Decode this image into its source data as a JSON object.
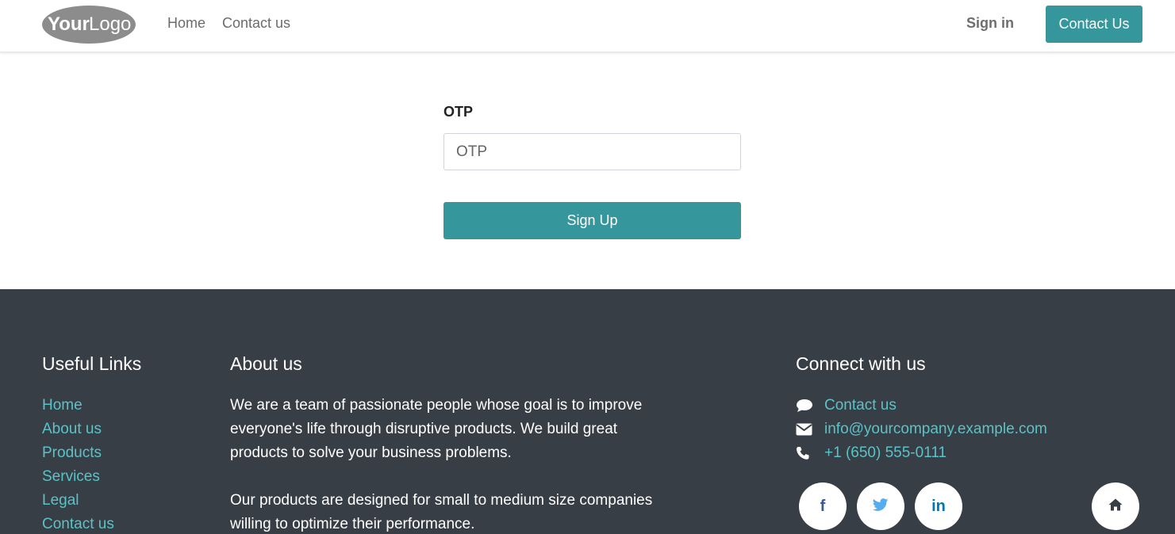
{
  "header": {
    "logo": {
      "text_bold": "Your",
      "text_light": "Logo"
    },
    "nav": [
      "Home",
      "Contact us"
    ],
    "sign_in": "Sign in",
    "contact_button": "Contact Us"
  },
  "form": {
    "otp_label": "OTP",
    "otp_placeholder": "OTP",
    "otp_value": "",
    "submit_label": "Sign Up"
  },
  "footer": {
    "useful_links": {
      "title": "Useful Links",
      "items": [
        "Home",
        "About us",
        "Products",
        "Services",
        "Legal",
        "Contact us"
      ]
    },
    "about": {
      "title": "About us",
      "paragraphs": [
        "We are a team of passionate people whose goal is to improve everyone's life through disruptive products. We build great products to solve your business problems.",
        "Our products are designed for small to medium size companies willing to optimize their performance."
      ]
    },
    "connect": {
      "title": "Connect with us",
      "items": [
        {
          "icon": "comment-icon",
          "text": "Contact us"
        },
        {
          "icon": "envelope-icon",
          "text": "info@yourcompany.example.com"
        },
        {
          "icon": "phone-icon",
          "text": "+1 (650) 555-0111"
        }
      ],
      "social": {
        "facebook": "f",
        "twitter": "twitter-icon",
        "linkedin": "in",
        "home": "home-icon"
      }
    }
  },
  "colors": {
    "accent": "#35979c",
    "link": "#5ac3c8",
    "footer_bg": "#383e45",
    "facebook": "#3b5998",
    "twitter": "#55acee",
    "linkedin": "#0077b5"
  }
}
